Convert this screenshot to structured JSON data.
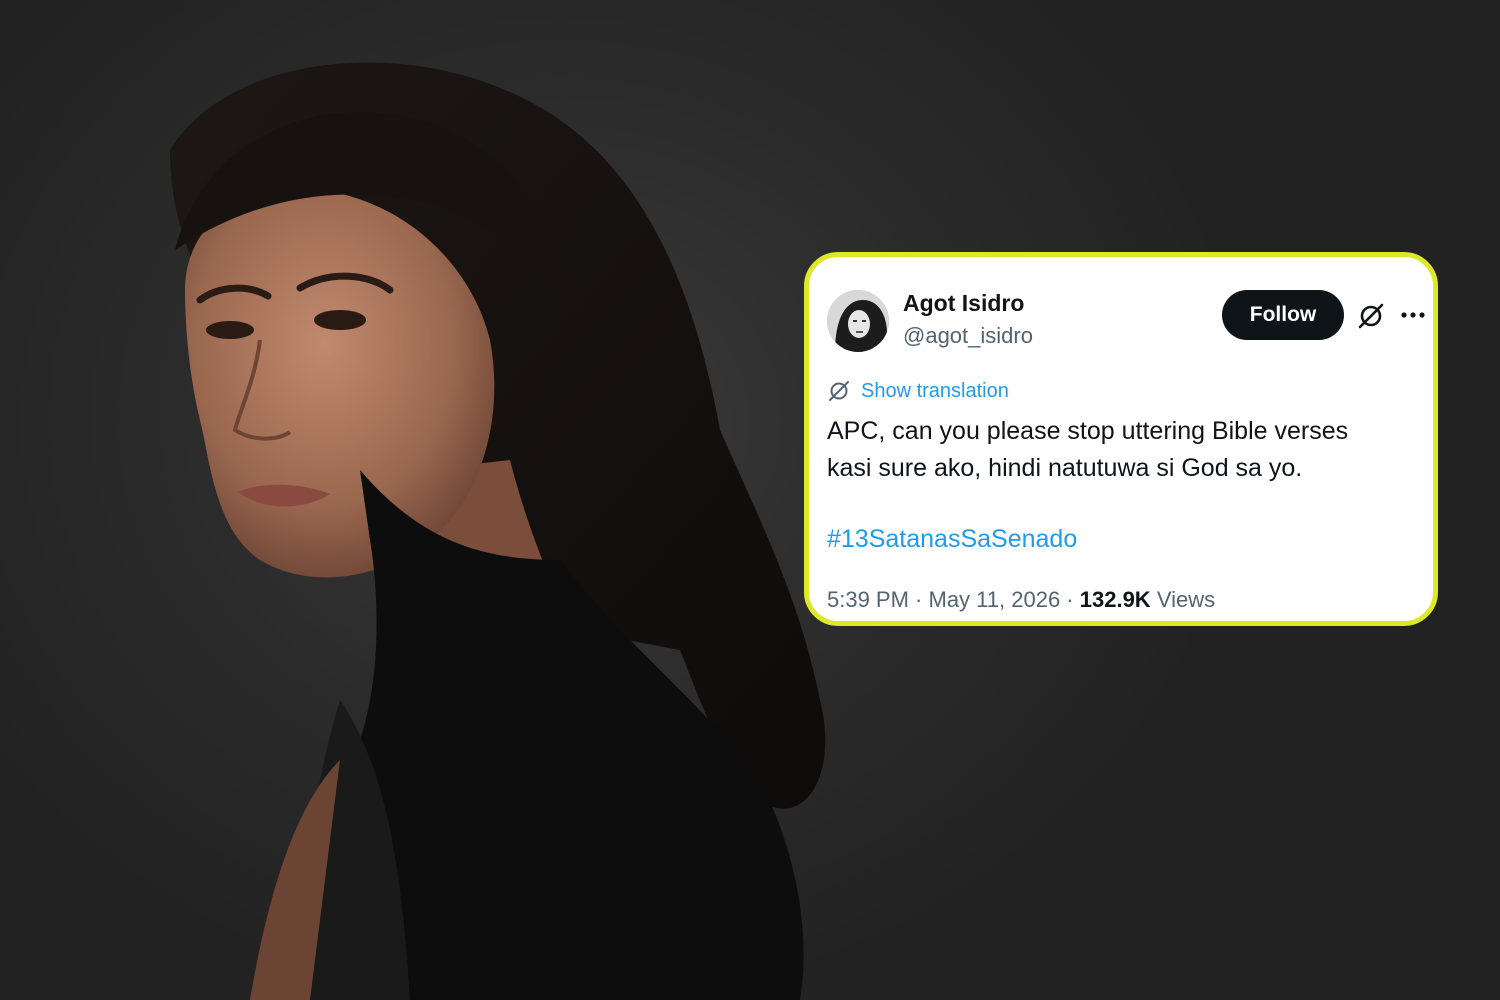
{
  "tweet": {
    "author_name": "Agot Isidro",
    "author_handle": "@agot_isidro",
    "follow_label": "Follow",
    "show_translation_label": "Show translation",
    "text_lines": [
      "APC, can you please stop uttering Bible verses",
      "kasi sure ako, hindi natutuwa si God sa yo."
    ],
    "hashtag": "#13SatanasSaSenado",
    "time": "5:39 PM",
    "separator": " · ",
    "date": "May 11, 2026",
    "views_count": "132.9K",
    "views_label": "Views"
  },
  "icons": {
    "avatar": "user-avatar-photo",
    "grok": "grok-icon",
    "more": "more-options-icon",
    "translate": "translate-icon"
  },
  "colors": {
    "card_border": "#dde82a",
    "link": "#1d9bf0",
    "follow_bg": "#0f1419",
    "text_primary": "#0f1419",
    "text_secondary": "#536471",
    "background": "#2a2a2a"
  }
}
